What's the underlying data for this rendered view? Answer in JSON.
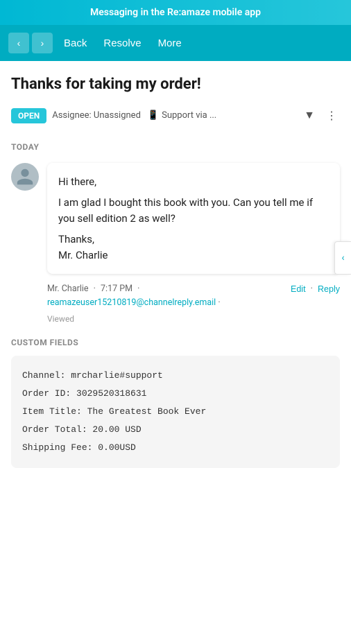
{
  "banner": {
    "text": "Messaging in the Re:amaze mobile app"
  },
  "header": {
    "back_label": "Back",
    "resolve_label": "Resolve",
    "more_label": "More"
  },
  "conversation": {
    "title": "Thanks for taking my order!",
    "status": "OPEN",
    "assignee_label": "Assignee: Unassigned",
    "channel_label": "Support via ...",
    "today_label": "TODAY"
  },
  "message": {
    "greeting": "Hi there,",
    "body": "I am glad I bought this book with you. Can you tell me if you sell edition 2 as well?",
    "sign_off": "Thanks,",
    "sender_name": "Mr. Charlie",
    "time": "7:17 PM",
    "email": "reamazeuser15210819@channelreply.email",
    "viewed": "Viewed",
    "edit_label": "Edit",
    "reply_label": "Reply"
  },
  "custom_fields": {
    "section_label": "CUSTOM FIELDS",
    "channel": "Channel: mrcharlie#support",
    "order_id": "Order ID: 3029520318631",
    "item_title": "Item Title: The Greatest Book Ever",
    "order_total": "Order Total: 20.00 USD",
    "shipping_fee": "Shipping Fee: 0.00USD"
  },
  "icons": {
    "arrow_left": "‹",
    "arrow_right": "›",
    "filter": "▼",
    "more_dots": "⋮",
    "chevron_left": "‹"
  }
}
